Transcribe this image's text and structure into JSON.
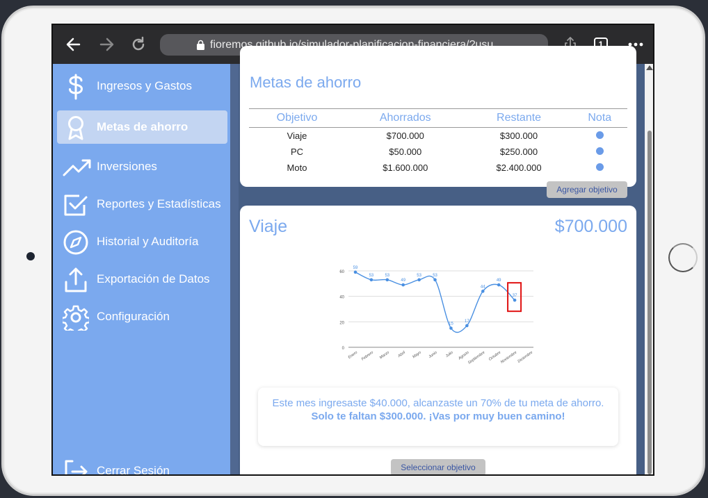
{
  "browser": {
    "url": "fioremos.github.io/simulador-planificacion-financiera/?usu…",
    "tabs_count": "1"
  },
  "sidebar": {
    "items": [
      {
        "label": "Ingresos y Gastos",
        "icon": "dollar-icon"
      },
      {
        "label": "Metas de ahorro",
        "icon": "ribbon-icon",
        "active": true
      },
      {
        "label": "Inversiones",
        "icon": "trending-up-icon"
      },
      {
        "label": "Reportes y Estadísticas",
        "icon": "checkbox-icon"
      },
      {
        "label": "Historial y Auditoría",
        "icon": "compass-icon"
      },
      {
        "label": "Exportación de Datos",
        "icon": "upload-icon"
      },
      {
        "label": "Configuración",
        "icon": "gear-icon"
      }
    ],
    "logout_label": "Cerrar Sesión"
  },
  "goals_card": {
    "title_partial": "Metas de ahorro",
    "columns": [
      "Objetivo",
      "Ahorrados",
      "Restante",
      "Nota"
    ],
    "rows": [
      {
        "objetivo": "Viaje",
        "ahorrados": "$700.000",
        "restante": "$300.000"
      },
      {
        "objetivo": "PC",
        "ahorrados": "$50.000",
        "restante": "$250.000"
      },
      {
        "objetivo": "Moto",
        "ahorrados": "$1.600.000",
        "restante": "$2.400.000"
      }
    ],
    "add_button": "Agregar objetivo"
  },
  "detail_card": {
    "goal_name": "Viaje",
    "goal_amount": "$700.000",
    "message_line1": "Este mes ingresaste $40.000, alcanzaste un 70% de tu meta de ahorro.",
    "message_line2": "Solo te faltan $300.000. ¡Vas por muy buen camino!",
    "select_button": "Seleccionar objetivo"
  },
  "chart_data": {
    "type": "line",
    "categories": [
      "Enero",
      "Febrero",
      "Marzo",
      "Abril",
      "Mayo",
      "Junio",
      "Julio",
      "Agosto",
      "Septiembre",
      "Octubre",
      "Noviembre",
      "Diciembre"
    ],
    "values": [
      59,
      53,
      53,
      49,
      53,
      53,
      15,
      17,
      44,
      49,
      37,
      null
    ],
    "yticks": [
      0,
      20,
      40,
      60
    ],
    "ylim": [
      0,
      60
    ],
    "highlight_index": 10,
    "line_color": "#4a90e2"
  }
}
